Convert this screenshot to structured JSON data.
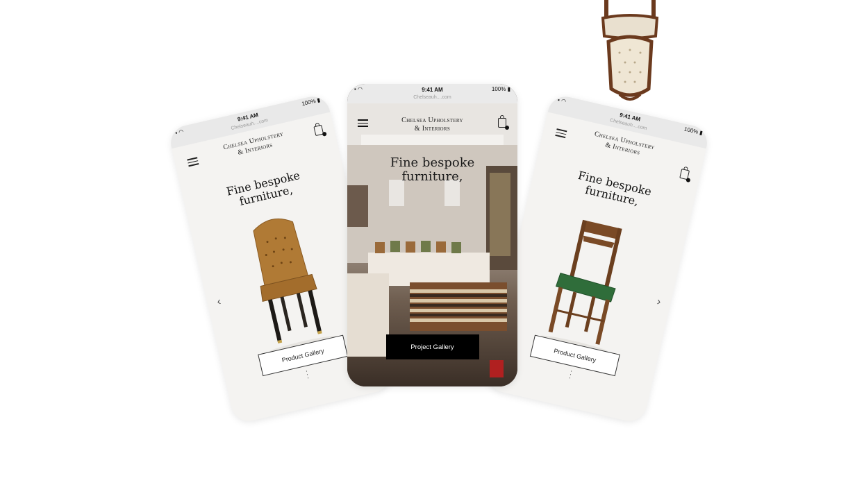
{
  "status": {
    "time": "9:41 AM",
    "battery": "100%",
    "url": "Chelseauh....com"
  },
  "brand": {
    "line1": "Chelsea Upholstery",
    "line2": "& Interiors"
  },
  "headline": {
    "line1": "Fine bespoke",
    "line2": "furniture,"
  },
  "buttons": {
    "product_gallery": "Product Gallery",
    "project_gallery": "Project Gallery"
  },
  "icons": {
    "menu": "hamburger-menu-icon",
    "bag": "shopping-bag-icon",
    "prev": "chevron-left-icon",
    "next": "chevron-right-icon",
    "dots": "vertical-dots-icon"
  },
  "colors": {
    "accent": "#000000",
    "chair_leather": "#b07a35",
    "chair_seat": "#2f6d3a",
    "wood": "#7a4a26"
  }
}
